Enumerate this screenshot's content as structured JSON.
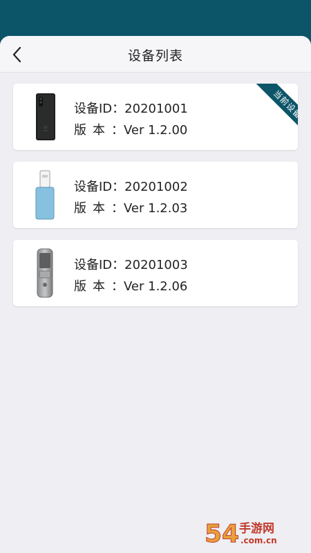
{
  "header": {
    "title": "设备列表",
    "back_icon": "chevron-left-icon"
  },
  "devices": [
    {
      "id_label": "设备ID：",
      "id": "20201001",
      "ver_label": "版本：",
      "version": "Ver 1.2.00",
      "badge": "当前设备",
      "image": "black-phone-device",
      "is_current": true
    },
    {
      "id_label": "设备ID：",
      "id": "20201002",
      "ver_label": "版本：",
      "version": "Ver 1.2.03",
      "image": "blue-usb-key-device",
      "is_current": false
    },
    {
      "id_label": "设备ID：",
      "id": "20201003",
      "ver_label": "版本：",
      "version": "Ver 1.2.06",
      "image": "silver-door-lock-device",
      "is_current": false
    }
  ],
  "watermark": {
    "brand": "54",
    "sub": "手游网",
    "domain": ".com.cn"
  },
  "colors": {
    "accent": "#0c5569",
    "background": "#efeef2",
    "card": "#ffffff"
  }
}
